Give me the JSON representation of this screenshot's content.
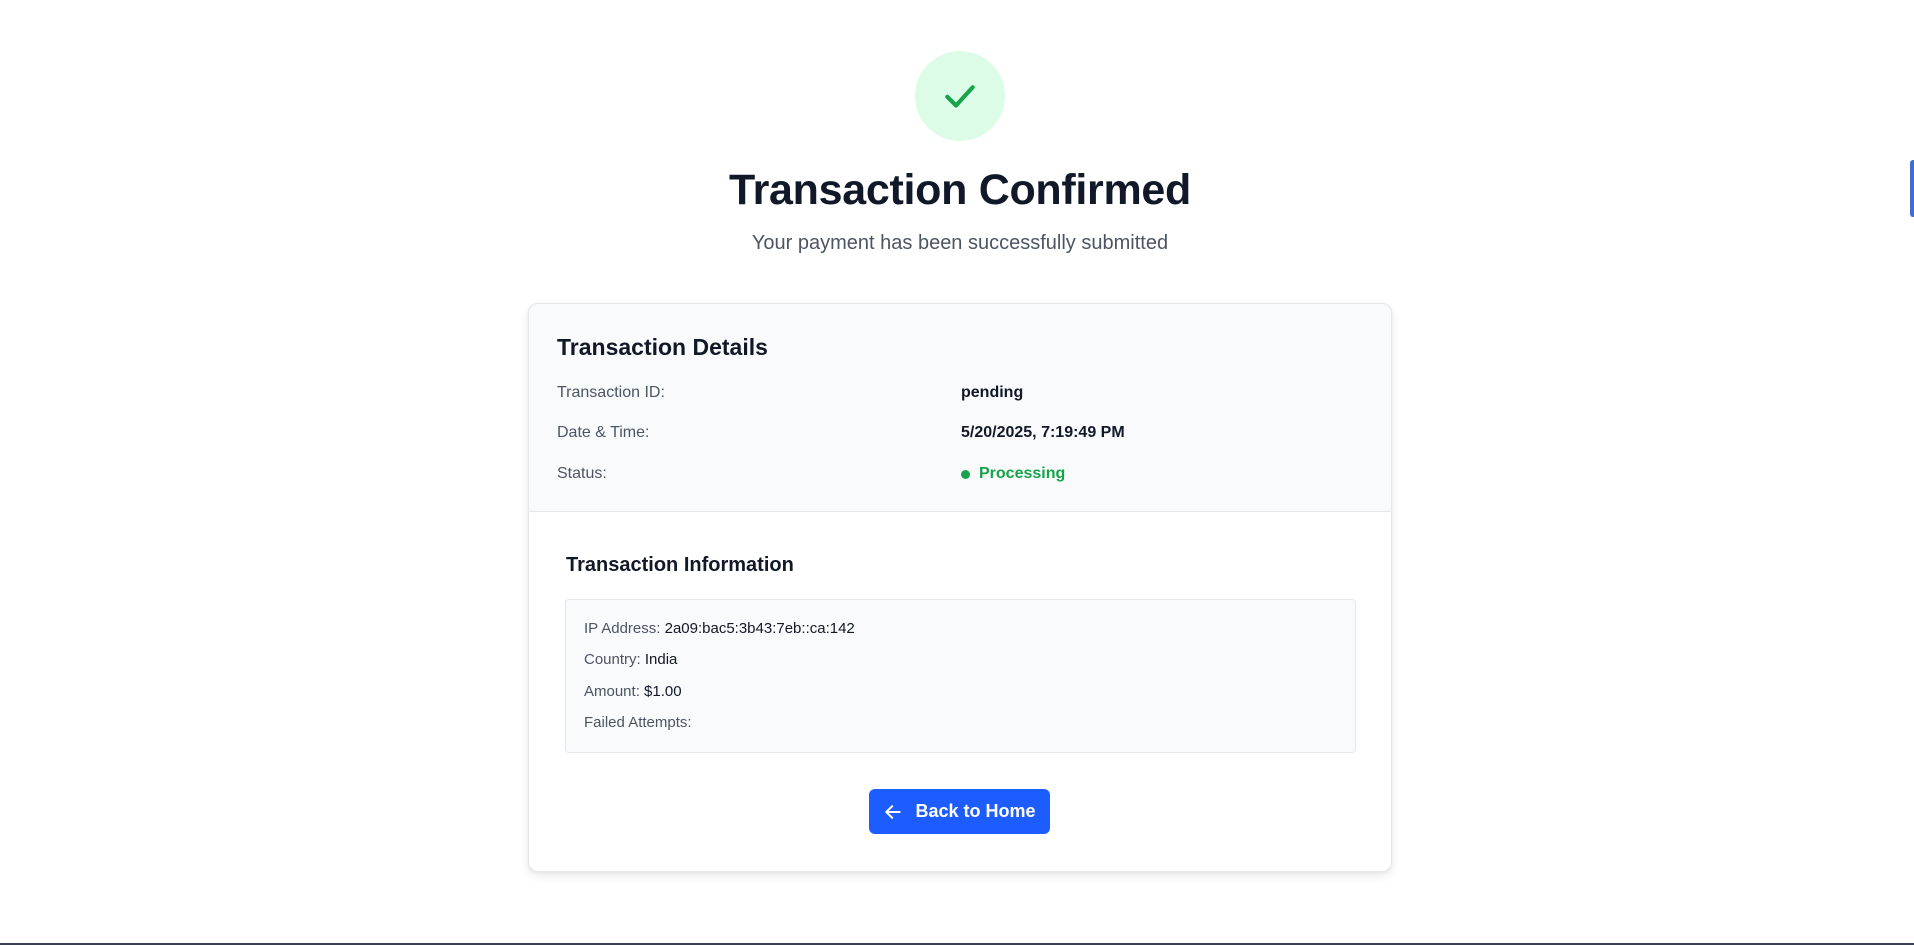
{
  "header": {
    "icon": "check-icon",
    "title": "Transaction Confirmed",
    "subtitle": "Your payment has been successfully submitted"
  },
  "details": {
    "title": "Transaction Details",
    "rows": [
      {
        "label": "Transaction ID:",
        "value": "pending"
      },
      {
        "label": "Date & Time:",
        "value": "5/20/2025, 7:19:49 PM"
      },
      {
        "label": "Status:",
        "value": "Processing"
      }
    ]
  },
  "info": {
    "title": "Transaction Information",
    "lines": [
      {
        "label": "IP Address:",
        "value": "2a09:bac5:3b43:7eb::ca:142"
      },
      {
        "label": "Country:",
        "value": "India"
      },
      {
        "label": "Amount:",
        "value": "$1.00"
      },
      {
        "label": "Failed Attempts:",
        "value": ""
      }
    ]
  },
  "actions": {
    "back_label": "Back to Home",
    "back_icon": "arrow-left-icon"
  },
  "colors": {
    "accent": "#1d5cff",
    "success": "#16a34a",
    "success_bg": "#dcfce7"
  }
}
